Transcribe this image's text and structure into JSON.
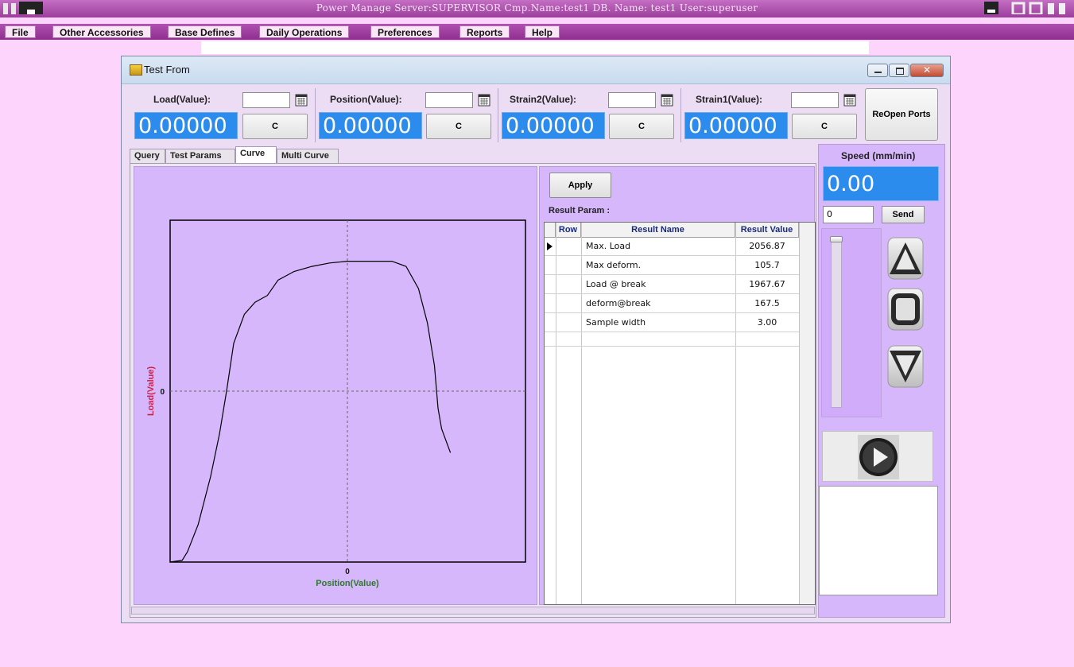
{
  "app": {
    "title": "Power Manage Server:SUPERVISOR  Cmp.Name:test1  DB. Name:  test1  User:superuser"
  },
  "menu": [
    "File",
    "Other Accessories",
    "Base Defines",
    "Daily Operations",
    "Preferences",
    "Reports",
    "Help"
  ],
  "window": {
    "title": "Test From"
  },
  "sensors": [
    {
      "label": "Load(Value):",
      "value": "0.00000",
      "input": "",
      "button": "C"
    },
    {
      "label": "Position(Value):",
      "value": "0.00000",
      "input": "",
      "button": "C"
    },
    {
      "label": "Strain2(Value):",
      "value": "0.00000",
      "input": "",
      "button": "C"
    },
    {
      "label": "Strain1(Value):",
      "value": "0.00000",
      "input": "",
      "button": "C"
    }
  ],
  "reopen_button": "ReOpen Ports",
  "tabs": [
    "Query",
    "Test Params",
    "Curve",
    "Multi Curve"
  ],
  "active_tab": "Curve",
  "chart_data": {
    "type": "line",
    "xlabel": "Position(Value)",
    "ylabel": "Load(Value)",
    "x_tick": "0",
    "y_tick": "0",
    "grid": "dashed crosshair at origin",
    "colors": {
      "xlabel": "#2a7a2a",
      "ylabel": "#d0204a",
      "line": "#000000"
    },
    "series": [
      {
        "values": [
          [
            -1.0,
            -1.0
          ],
          [
            -0.93,
            -0.99
          ],
          [
            -0.9,
            -0.94
          ],
          [
            -0.84,
            -0.78
          ],
          [
            -0.77,
            -0.5
          ],
          [
            -0.72,
            -0.25
          ],
          [
            -0.68,
            0.0
          ],
          [
            -0.64,
            0.28
          ],
          [
            -0.58,
            0.45
          ],
          [
            -0.52,
            0.52
          ],
          [
            -0.45,
            0.56
          ],
          [
            -0.39,
            0.65
          ],
          [
            -0.3,
            0.7
          ],
          [
            -0.2,
            0.73
          ],
          [
            -0.1,
            0.75
          ],
          [
            0.0,
            0.76
          ],
          [
            0.12,
            0.76
          ],
          [
            0.25,
            0.76
          ],
          [
            0.33,
            0.73
          ],
          [
            0.4,
            0.6
          ],
          [
            0.45,
            0.4
          ],
          [
            0.49,
            0.15
          ],
          [
            0.51,
            -0.1
          ],
          [
            0.53,
            -0.22
          ],
          [
            0.58,
            -0.36
          ]
        ]
      }
    ]
  },
  "apply_button": "Apply",
  "result_param_label": "Result Param :",
  "grid": {
    "columns": [
      "Row",
      "Result Name",
      "Result Value"
    ],
    "rows": [
      {
        "name": "Max. Load",
        "value": "2056.87"
      },
      {
        "name": "Max deform.",
        "value": "105.7"
      },
      {
        "name": "Load @ break",
        "value": "1967.67"
      },
      {
        "name": "deform@break",
        "value": "167.5"
      },
      {
        "name": "Sample width",
        "value": "3.00"
      },
      {
        "name": "",
        "value": ""
      }
    ]
  },
  "speed": {
    "label": "Speed (mm/min)",
    "value": "0.00",
    "input": "0",
    "send_button": "Send",
    "slider_level": 0
  },
  "icons": {
    "calendar": "calendar-icon",
    "up": "arrow-up-icon",
    "stop": "stop-icon",
    "down": "arrow-down-icon",
    "play": "play-icon"
  }
}
